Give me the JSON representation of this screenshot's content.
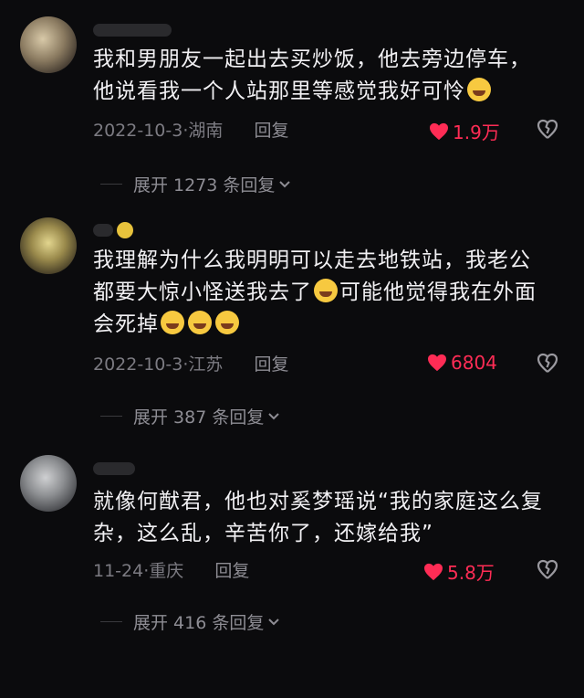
{
  "comments": [
    {
      "text1": "我和男朋友一起出去买炒饭，他去旁边停车，",
      "text2": "他说看我一个人站那里等感觉我好可怜",
      "date": "2022-10-3",
      "sep": "·",
      "location": "湖南",
      "reply_label": "回复",
      "likes": "1.9万",
      "expand": "展开 1273 条回复"
    },
    {
      "text1": "我理解为什么我明明可以走去地铁站，我老公",
      "text2a": "都要大惊小怪送我去了",
      "text2b": "可能他觉得我在外面",
      "text3": "会死掉",
      "date": "2022-10-3",
      "sep": "·",
      "location": "江苏",
      "reply_label": "回复",
      "likes": "6804",
      "expand": "展开 387 条回复"
    },
    {
      "text1": "就像何猷君，他也对奚梦瑶说“我的家庭这么复",
      "text2": "杂，这么乱，辛苦你了，还嫁给我”",
      "date": "11-24",
      "sep": "·",
      "location": "重庆",
      "reply_label": "回复",
      "likes": "5.8万",
      "expand": "展开 416 条回复"
    }
  ],
  "colors": {
    "like": "#ff2c55",
    "background": "#0b0b0d",
    "meta": "#7c7b82"
  }
}
